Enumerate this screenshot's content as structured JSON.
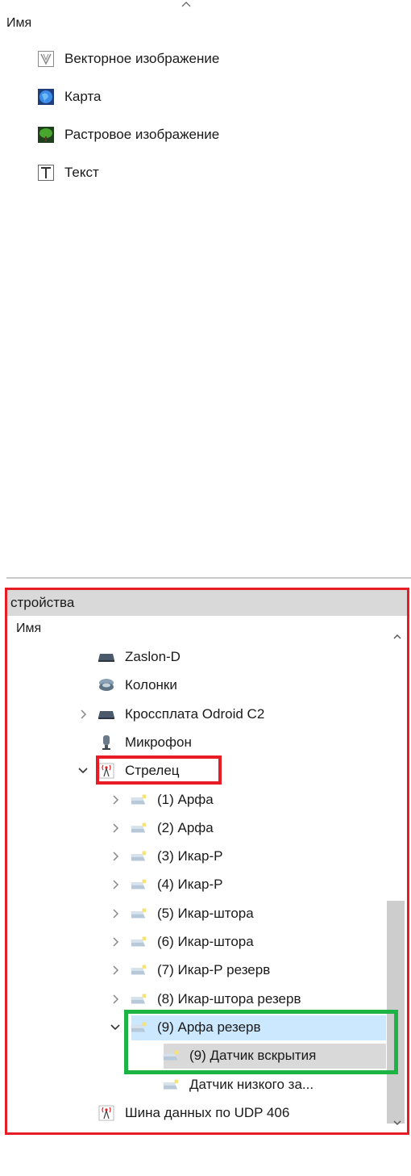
{
  "top_panel": {
    "column_header": "Имя",
    "items": [
      {
        "label": "Векторное изображение",
        "icon": "vector-image-icon"
      },
      {
        "label": "Карта",
        "icon": "globe-icon"
      },
      {
        "label": "Растровое изображение",
        "icon": "raster-image-icon"
      },
      {
        "label": "Текст",
        "icon": "text-icon"
      }
    ]
  },
  "devices_panel": {
    "title": "стройства",
    "column_header": "Имя",
    "rows": [
      {
        "label": "Zaslon-D",
        "icon": "device-board-icon",
        "chevron": "none"
      },
      {
        "label": "Колонки",
        "icon": "speaker-icon",
        "chevron": "none"
      },
      {
        "label": "Кросcплата Odroid C2",
        "icon": "device-board-icon",
        "chevron": "collapsed"
      },
      {
        "label": "Микрофон",
        "icon": "microphone-icon",
        "chevron": "none"
      },
      {
        "label": "Стрелец",
        "icon": "radio-tower-icon",
        "chevron": "expanded"
      },
      {
        "label": "(1) Арфа",
        "icon": "sensor-icon",
        "chevron": "collapsed"
      },
      {
        "label": "(2) Арфа",
        "icon": "sensor-icon",
        "chevron": "collapsed"
      },
      {
        "label": "(3) Икар-Р",
        "icon": "sensor-icon",
        "chevron": "collapsed"
      },
      {
        "label": "(4) Икар-Р",
        "icon": "sensor-icon",
        "chevron": "collapsed"
      },
      {
        "label": "(5) Икар-штора",
        "icon": "sensor-icon",
        "chevron": "collapsed"
      },
      {
        "label": "(6) Икар-штора",
        "icon": "sensor-icon",
        "chevron": "collapsed"
      },
      {
        "label": "(7) Икар-Р резерв",
        "icon": "sensor-icon",
        "chevron": "collapsed"
      },
      {
        "label": "(8) Икар-штора резерв",
        "icon": "sensor-icon",
        "chevron": "collapsed"
      },
      {
        "label": "(9) Арфа резерв",
        "icon": "sensor-icon",
        "chevron": "expanded"
      },
      {
        "label": "(9) Датчик вскрытия",
        "icon": "sensor-icon",
        "chevron": "none"
      },
      {
        "label": "Датчик низкого за...",
        "icon": "sensor-icon",
        "chevron": "none"
      },
      {
        "label": "Шина данных по UDP 406",
        "icon": "radio-tower-icon",
        "chevron": "none"
      }
    ]
  },
  "colors": {
    "highlight_red": "#e81c24",
    "highlight_green": "#1db445",
    "selection_blue": "#cce8ff",
    "selection_gray": "#d9d9d9"
  }
}
